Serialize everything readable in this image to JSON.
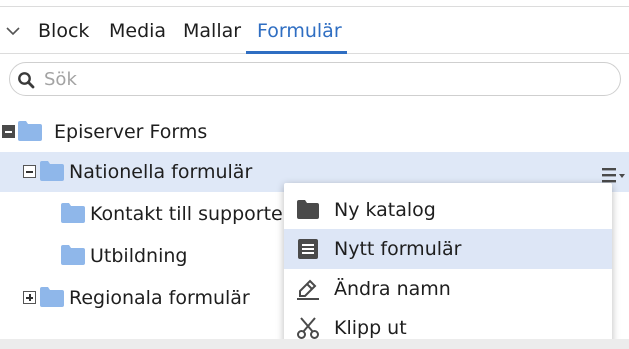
{
  "tabs": [
    {
      "label": "Block"
    },
    {
      "label": "Media"
    },
    {
      "label": "Mallar"
    },
    {
      "label": "Formulär",
      "active": true
    }
  ],
  "search": {
    "placeholder": "Sök",
    "value": ""
  },
  "tree": [
    {
      "label": "Episerver Forms",
      "toggle": "collapse",
      "selected": false
    },
    {
      "label": "Nationella formulär",
      "toggle": "collapse",
      "selected": true
    },
    {
      "label": "Kontakt till supporten",
      "toggle": "none",
      "selected": false
    },
    {
      "label": "Utbildning",
      "toggle": "none",
      "selected": false
    },
    {
      "label": "Regionala formulär",
      "toggle": "expand",
      "selected": false
    }
  ],
  "context_menu": {
    "items": [
      {
        "label": "Ny katalog",
        "icon": "folder-icon"
      },
      {
        "label": "Nytt formulär",
        "icon": "form-icon",
        "hover": true
      },
      {
        "label": "Ändra namn",
        "icon": "rename-pencil-icon"
      },
      {
        "label": "Klipp ut",
        "icon": "scissors-icon"
      }
    ]
  },
  "colors": {
    "accent": "#2f6ec2",
    "selected_row": "#dfe8f7",
    "menu_hover": "#dde6f6",
    "folder": "#8fb7ea"
  }
}
